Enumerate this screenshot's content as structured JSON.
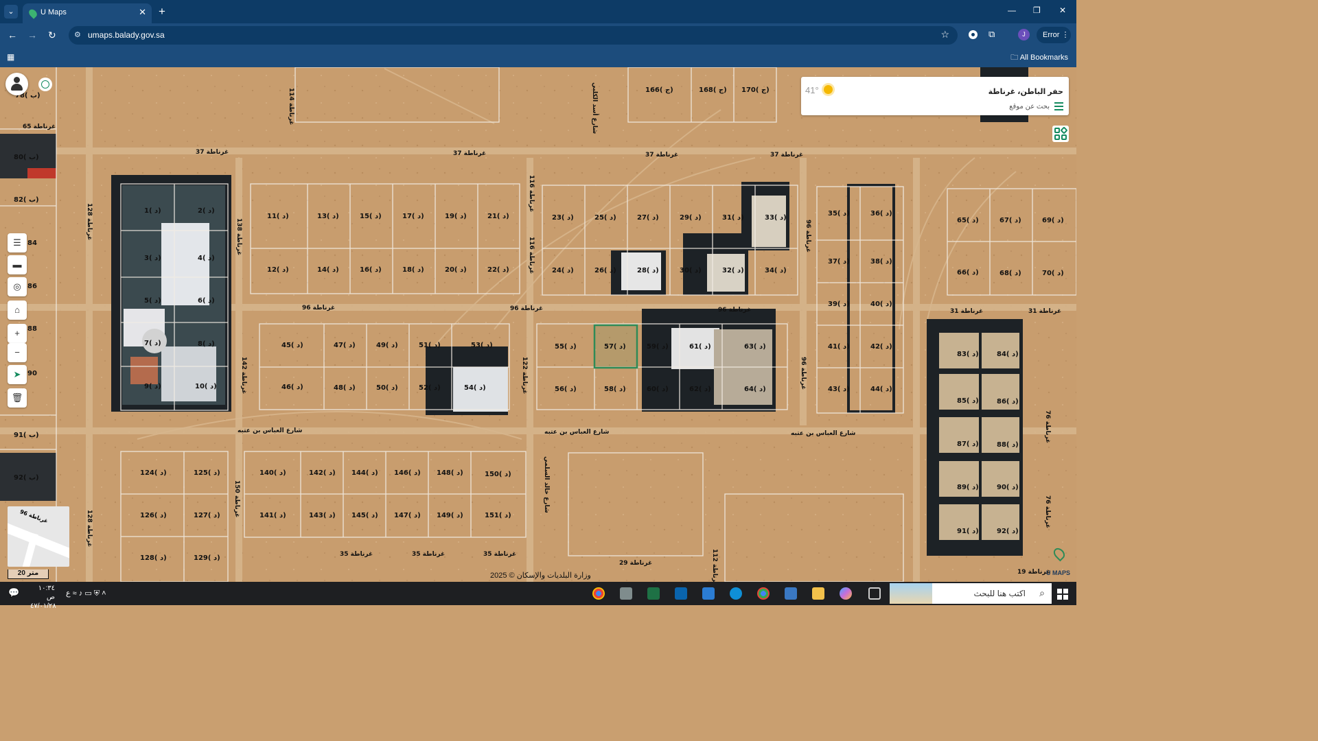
{
  "browser": {
    "tab_title": "U Maps",
    "url": "umaps.balady.gov.sa",
    "error_label": "Error",
    "bookmarks_label": "All Bookmarks",
    "profile_initial": "J"
  },
  "info_panel": {
    "location": "حفر الباطن، غرناطة",
    "search_label": "بحث عن موقع",
    "temperature": "41°"
  },
  "map": {
    "scale_label": "20 متر",
    "copyright": "وزارة البلديات والإسكان © 2025",
    "logo_text": "U MAPS",
    "highlight_color": "#2e8b57",
    "minimap_label": "غرناطة 96",
    "street_labels": {
      "s37a": "غرناطة 37",
      "s37b": "غرناطة 37",
      "s37c": "غرناطة 37",
      "s37d": "غرناطة 37",
      "s65": "غرناطة 65",
      "s96a": "غرناطة 96",
      "s96b": "غرناطة 96",
      "s96c": "غرناطة 96",
      "s31a": "غرناطة 31",
      "s31b": "غرناطة 31",
      "abbas1": "شارع العباس بن عتبه",
      "abbas2": "شارع العباس بن عتبه",
      "abbas3": "شارع العباس بن عتبه",
      "s35a": "غرناطة 35",
      "s35b": "غرناطة 35",
      "s35c": "غرناطة 35",
      "s29": "غرناطة 29",
      "s19": "غرناطة 19",
      "v114": "غرناطة 114",
      "v116a": "غرناطة 116",
      "v116b": "غرناطة 116",
      "v128a": "غرناطة 128",
      "v128b": "غرناطة 128",
      "v138": "غرناطة 138",
      "v142": "غرناطة 142",
      "v150": "غرناطة 150",
      "v122": "غرناطة 122",
      "v112": "غرناطة 112",
      "v96a": "غرناطة 96",
      "v96b": "غرناطة 96",
      "v76a": "غرناطة 76",
      "v76b": "غرناطة 76",
      "asad": "شارع أسد الكلبي",
      "khalid": "شارع خالد السلمي"
    },
    "parcels": {
      "p78": "78( ب)",
      "p80": "80( ب)",
      "p82": "82( ب)",
      "p84": "84",
      "p86": "86",
      "p88": "88",
      "p90": "90",
      "p91": "91( ب)",
      "p92": "92( ب)",
      "p1": "1( د)",
      "p2": "2( د)",
      "p3": "3( د)",
      "p4": "4( د)",
      "p5": "5( د)",
      "p6": "6( د)",
      "p7": "7( د)",
      "p8": "8( د)",
      "p9": "9( د)",
      "p10": "10( د)",
      "p11": "11( د)",
      "p12": "12( د)",
      "p13": "13( د)",
      "p14": "14( د)",
      "p15": "15( د)",
      "p16": "16( د)",
      "p17": "17( د)",
      "p18": "18( د)",
      "p19": "19( د)",
      "p20": "20( د)",
      "p21": "21( د)",
      "p22": "22( د)",
      "p23": "23( د)",
      "p24": "24( د)",
      "p25": "25( د)",
      "p26": "26( د)",
      "p27": "27( د)",
      "p28": "28( د)",
      "p29": "29( د)",
      "p30": "30( د)",
      "p31": "31( د)",
      "p32": "32( د)",
      "p33": "33( د)",
      "p34": "34( د)",
      "p35": "35( د)",
      "p36": "36( د)",
      "p37": "37( د)",
      "p38": "38( د)",
      "p39": "39( د)",
      "p40": "40( د)",
      "p41": "41( د)",
      "p42": "42( د)",
      "p43": "43( د)",
      "p44": "44( د)",
      "p45": "45( د)",
      "p46": "46( د)",
      "p47": "47( د)",
      "p48": "48( د)",
      "p49": "49( د)",
      "p50": "50( د)",
      "p51": "51( د)",
      "p52": "52( د)",
      "p53": "53( د)",
      "p54": "54( د)",
      "p55": "55( د)",
      "p56": "56( د)",
      "p57": "57( د)",
      "p58": "58( د)",
      "p59": "59( د)",
      "p60": "60( د)",
      "p61": "61( د)",
      "p62": "62( د)",
      "p63": "63( د)",
      "p64": "64( د)",
      "p65": "65( د)",
      "p66": "66( د)",
      "p67": "67( د)",
      "p68": "68( د)",
      "p69": "69( د)",
      "p70": "70( د)",
      "r83": "83( د)",
      "r84": "84( د)",
      "r85": "85( د)",
      "r86": "86( د)",
      "r87": "87( د)",
      "r88": "88( د)",
      "r89": "89( د)",
      "r90": "90( د)",
      "r91": "91( د)",
      "r92": "92( د)",
      "p124": "124( د)",
      "p125": "125( د)",
      "p126": "126( د)",
      "p127": "127( د)",
      "p128": "128( د)",
      "p129": "129( د)",
      "p140": "140( د)",
      "p141": "141( د)",
      "p142": "142( د)",
      "p143": "143( د)",
      "p144": "144( د)",
      "p145": "145( د)",
      "p146": "146( د)",
      "p147": "147( د)",
      "p148": "148( د)",
      "p149": "149( د)",
      "p150": "150( د)",
      "p151": "151( د)",
      "p166": "166( ج)",
      "p168": "168( ج)",
      "p170": "170( ج)"
    }
  },
  "taskbar": {
    "time": "١٠:٣٤ ص",
    "date": "٤٧/٠١/٢٨",
    "lang": "ع",
    "search_placeholder": "اكتب هنا للبحث"
  }
}
